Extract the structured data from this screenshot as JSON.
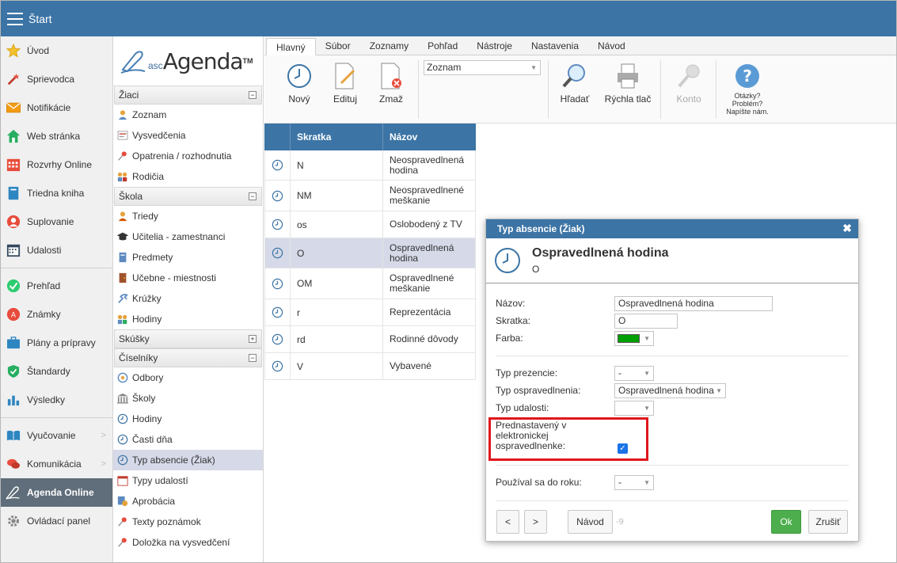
{
  "topbar": {
    "title": "Štart"
  },
  "leftnav": {
    "items": [
      {
        "label": "Úvod",
        "icon": "star-icon"
      },
      {
        "label": "Sprievodca",
        "icon": "wand-icon"
      },
      {
        "label": "Notifikácie",
        "icon": "envelope-icon"
      },
      {
        "label": "Web stránka",
        "icon": "home-icon"
      },
      {
        "label": "Rozvrhy Online",
        "icon": "calendar-grid-icon"
      },
      {
        "label": "Triedna kniha",
        "icon": "book-icon"
      },
      {
        "label": "Suplovanie",
        "icon": "person-icon"
      },
      {
        "label": "Udalosti",
        "icon": "calendar-icon"
      },
      {
        "label": "Prehľad",
        "icon": "check-circle-icon"
      },
      {
        "label": "Známky",
        "icon": "grade-icon"
      },
      {
        "label": "Plány a prípravy",
        "icon": "briefcase-icon"
      },
      {
        "label": "Štandardy",
        "icon": "shield-icon"
      },
      {
        "label": "Výsledky",
        "icon": "bar-chart-icon"
      },
      {
        "label": "Vyučovanie",
        "icon": "open-book-icon"
      },
      {
        "label": "Komunikácia",
        "icon": "chat-icon"
      },
      {
        "label": "Agenda Online",
        "icon": "agenda-icon"
      },
      {
        "label": "Ovládací panel",
        "icon": "gear-icon"
      }
    ]
  },
  "logo": {
    "prefix": "asc",
    "name": "Agenda",
    "tm": "TM"
  },
  "midpanel": {
    "sections": [
      {
        "title": "Žiaci",
        "toggle": "−",
        "items": [
          "Zoznam",
          "Vysvedčenia",
          "Opatrenia / rozhodnutia",
          "Rodičia"
        ]
      },
      {
        "title": "Škola",
        "toggle": "−",
        "items": [
          "Triedy",
          "Učitelia - zamestnanci",
          "Predmety",
          "Učebne - miestnosti",
          "Krúžky",
          "Hodiny"
        ]
      },
      {
        "title": "Skúšky",
        "toggle": "+",
        "items": []
      },
      {
        "title": "Číselníky",
        "toggle": "−",
        "items": [
          "Odbory",
          "Školy",
          "Hodiny",
          "Časti dňa",
          "Typ absencie (Žiak)",
          "Typy udalostí",
          "Aprobácia",
          "Texty poznámok",
          "Doložka na vysvedčení"
        ]
      }
    ]
  },
  "ribbon": {
    "tabs": [
      "Hlavný",
      "Súbor",
      "Zoznamy",
      "Pohľad",
      "Nástroje",
      "Nastavenia",
      "Návod"
    ],
    "buttons": {
      "novy": "Nový",
      "edituj": "Edituj",
      "zmaz": "Zmaž",
      "hladat": "Hľadať",
      "tlac": "Rýchla tlač",
      "konto": "Konto",
      "help1": "Otázky?",
      "help2": "Problém?",
      "help3": "Napíšte nám."
    },
    "combo": "Zoznam"
  },
  "table": {
    "headers": [
      "Skratka",
      "Názov"
    ],
    "rows": [
      {
        "code": "N",
        "name1": "Neospravedlnená",
        "name2": "hodina"
      },
      {
        "code": "NM",
        "name1": "Neospravedlnené",
        "name2": "meškanie"
      },
      {
        "code": "os",
        "name1": "Oslobodený z TV",
        "name2": ""
      },
      {
        "code": "O",
        "name1": "Ospravedlnená",
        "name2": "hodina"
      },
      {
        "code": "OM",
        "name1": "Ospravedlnené",
        "name2": "meškanie"
      },
      {
        "code": "r",
        "name1": "Reprezentácia",
        "name2": ""
      },
      {
        "code": "rd",
        "name1": "Rodinné dôvody",
        "name2": ""
      },
      {
        "code": "V",
        "name1": "Vybavené",
        "name2": ""
      }
    ]
  },
  "dialog": {
    "title": "Typ absencie (Žiak)",
    "close": "✖",
    "heading": "Ospravedlnená hodina",
    "subheading": "O",
    "labels": {
      "nazov": "Názov:",
      "skratka": "Skratka:",
      "farba": "Farba:",
      "typ_prezencie": "Typ prezencie:",
      "typ_ospravedlnenia": "Typ ospravedlnenia:",
      "typ_udalosti": "Typ udalosti:",
      "prednastaveny1": "Prednastavený v",
      "prednastaveny2": "elektronickej",
      "prednastaveny3": "ospravedlnenke:",
      "pouzival": "Používal sa do roku:"
    },
    "values": {
      "nazov": "Ospravedlnená hodina",
      "skratka": "O",
      "farba": "#00a000",
      "typ_prezencie": "-",
      "typ_ospravedlnenia": "Ospravedlnená hodina",
      "typ_udalosti": "",
      "pouzival": "-"
    },
    "buttons": {
      "prev": "<",
      "next": ">",
      "navod": "Návod",
      "counter": "-9",
      "ok": "Ok",
      "cancel": "Zrušiť"
    }
  },
  "colors": {
    "accent": "#3c74a5",
    "ok": "#4cae4c",
    "highlight": "#e0161c",
    "selected_row": "#d6d9e8"
  }
}
